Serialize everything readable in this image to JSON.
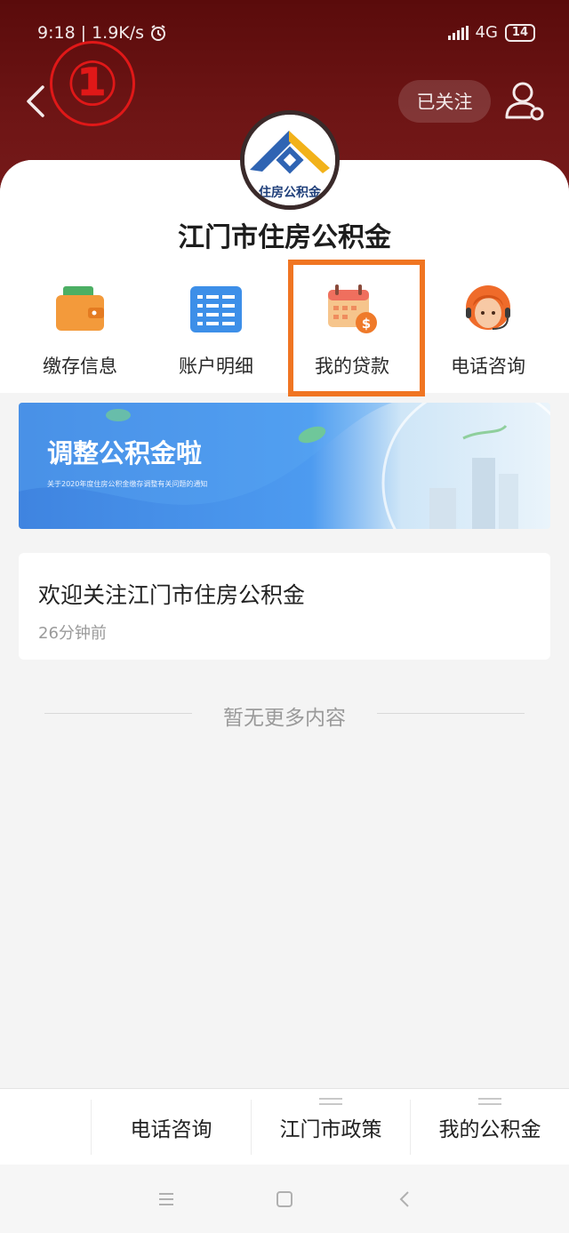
{
  "status_bar": {
    "time": "9:18",
    "speed": "1.9K/s",
    "network": "4G",
    "battery": "14"
  },
  "annotation": {
    "label": "①"
  },
  "header": {
    "follow_label": "已关注"
  },
  "logo": {
    "text": "住房公积金"
  },
  "account_name": "江门市住房公积金",
  "menu": [
    {
      "label": "缴存信息",
      "icon": "wallet-icon"
    },
    {
      "label": "账户明细",
      "icon": "list-icon"
    },
    {
      "label": "我的贷款",
      "icon": "calendar-money-icon"
    },
    {
      "label": "电话咨询",
      "icon": "customer-service-icon"
    }
  ],
  "banner": {
    "title": "调整公积金啦",
    "subtitle": "关于2020年度住房公积金缴存调整有关问题的通知"
  },
  "message": {
    "title": "欢迎关注江门市住房公积金",
    "time": "26分钟前"
  },
  "no_more_text": "暂无更多内容",
  "bottom_tabs": [
    {
      "label": "电话咨询"
    },
    {
      "label": "江门市政策"
    },
    {
      "label": "我的公积金"
    }
  ],
  "colors": {
    "header_bg": "#6e1515",
    "highlight": "#f07522",
    "annotation": "#e01818",
    "banner_blue": "#4d9bf0"
  }
}
